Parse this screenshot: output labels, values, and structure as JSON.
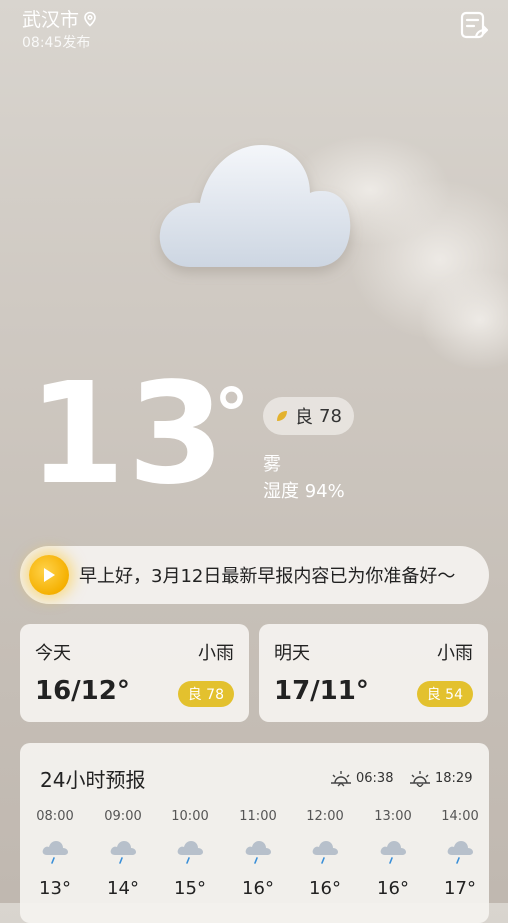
{
  "header": {
    "city": "武汉市",
    "publish_time": "08:45发布"
  },
  "current": {
    "temperature": "13",
    "degree_symbol": "°",
    "aqi_label": "良",
    "aqi_value": "78",
    "condition": "雾",
    "humidity": "湿度 94%"
  },
  "briefing": {
    "text": "早上好，3月12日最新早报内容已为你准备好～"
  },
  "days": [
    {
      "label": "今天",
      "weather": "小雨",
      "range": "16/12°",
      "aqi": "良 78"
    },
    {
      "label": "明天",
      "weather": "小雨",
      "range": "17/11°",
      "aqi": "良 54"
    }
  ],
  "hourly": {
    "title": "24小时预报",
    "sunrise": "06:38",
    "sunset": "18:29",
    "items": [
      {
        "time": "08:00",
        "temp": "13°",
        "icon": "light-rain-icon"
      },
      {
        "time": "09:00",
        "temp": "14°",
        "icon": "light-rain-icon"
      },
      {
        "time": "10:00",
        "temp": "15°",
        "icon": "light-rain-icon"
      },
      {
        "time": "11:00",
        "temp": "16°",
        "icon": "light-rain-icon"
      },
      {
        "time": "12:00",
        "temp": "16°",
        "icon": "light-rain-icon"
      },
      {
        "time": "13:00",
        "temp": "16°",
        "icon": "light-rain-icon"
      },
      {
        "time": "14:00",
        "temp": "17°",
        "icon": "light-rain-icon"
      }
    ]
  },
  "colors": {
    "accent_yellow": "#f5b000",
    "aqi_badge": "#e3c12e"
  }
}
